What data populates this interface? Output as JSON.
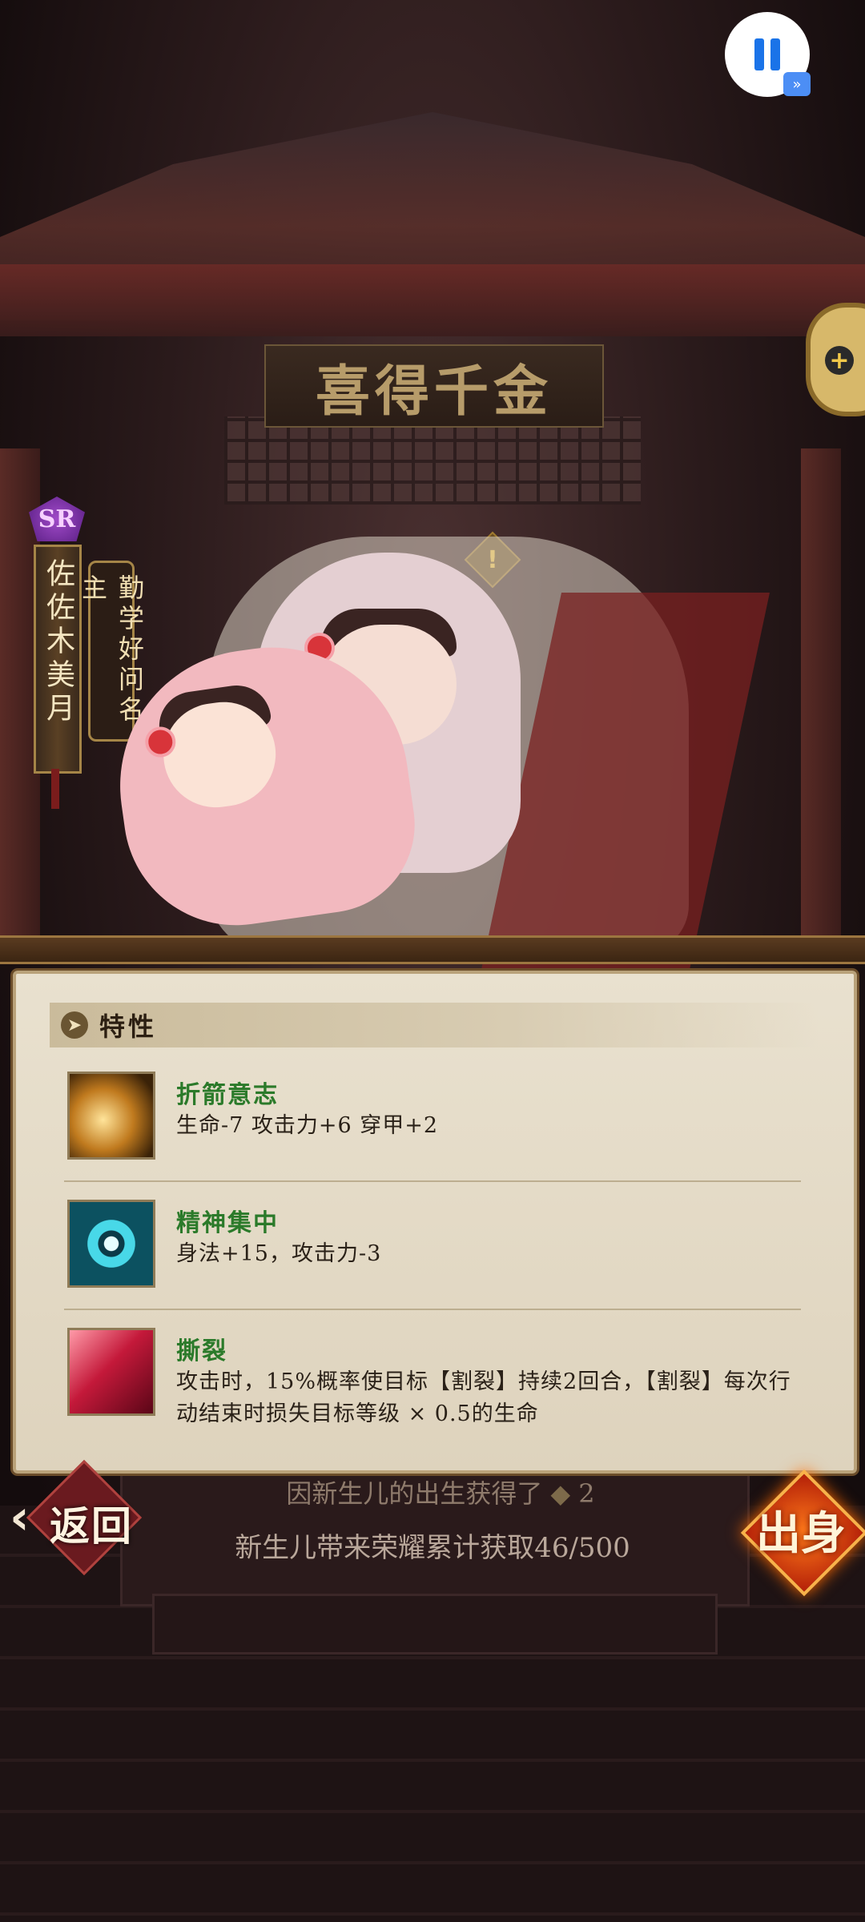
{
  "title": "喜得千金",
  "character": {
    "rarity": "SR",
    "name": "佐佐木美月",
    "title": "勤学好问名主"
  },
  "traits_section": {
    "label": "特性",
    "items": [
      {
        "name": "折箭意志",
        "desc": "生命-7  攻击力+6  穿甲+2",
        "icon": "spear-icon"
      },
      {
        "name": "精神集中",
        "desc": "身法+15，攻击力-3",
        "icon": "eye-icon"
      },
      {
        "name": "撕裂",
        "desc": "攻击时，15%概率使目标【割裂】持续2回合，【割裂】每次行动结束时损失目标等级 × 0.5的生命",
        "icon": "claw-icon"
      }
    ]
  },
  "footer": {
    "info_partial": "因新生儿的出生获得了",
    "info_partial_value": "2",
    "glory": "新生儿带来荣耀累计获取46/500"
  },
  "buttons": {
    "back": "返回",
    "birth": "出身"
  },
  "colors": {
    "trait_name": "#2b7a2a",
    "panel_bg": "#e9e1cf",
    "pause_accent": "#1a73e8"
  }
}
